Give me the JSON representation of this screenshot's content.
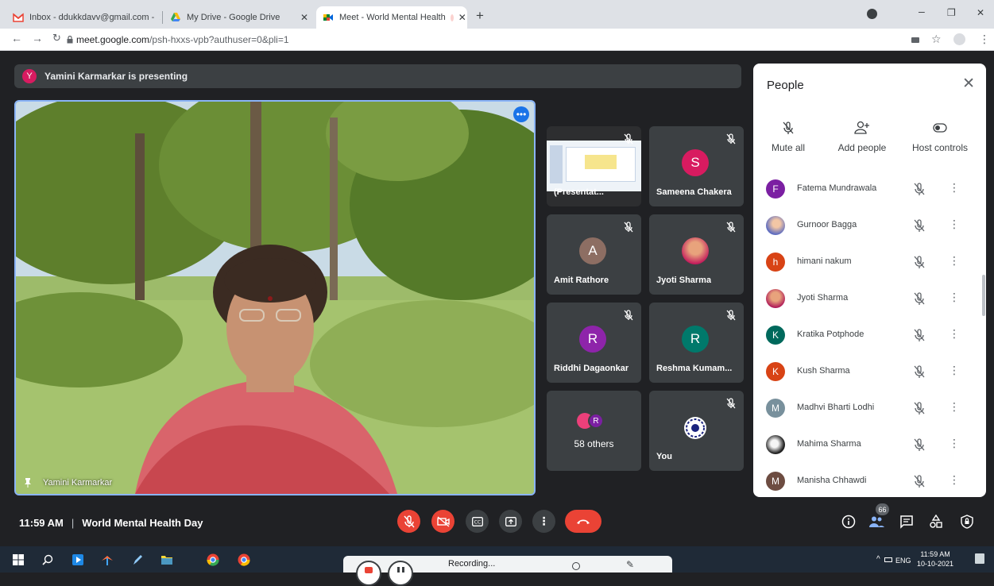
{
  "browser": {
    "tabs": [
      {
        "title": "Inbox - ddukkdavv@gmail.com - ",
        "active": false
      },
      {
        "title": "My Drive - Google Drive",
        "active": false
      },
      {
        "title": "Meet - World Mental Health",
        "active": true
      }
    ],
    "new_tab": "+",
    "url_host": "meet.google.com",
    "url_path": "/psh-hxxs-vpb?authuser=0&pli=1",
    "window_controls": {
      "minimize": "–",
      "maximize": "❐",
      "close": "✕"
    }
  },
  "meet": {
    "presenting_avatar": "Y",
    "presenting_text": "Yamini Karmarkar is presenting",
    "main_speaker": "Yamini Karmarkar",
    "tiles": [
      {
        "name": "(Presentat...",
        "type": "presentation"
      },
      {
        "name": "Sameena Chakera",
        "avatar": "S",
        "color": "#d81b60"
      },
      {
        "name": "Amit Rathore",
        "avatar": "A",
        "color": "#8d6e63"
      },
      {
        "name": "Jyoti Sharma",
        "avatar": "",
        "color": "#c2185b"
      },
      {
        "name": "Riddhi Dagaonkar",
        "avatar": "R",
        "color": "#8e24aa"
      },
      {
        "name": "Reshma Kumam...",
        "avatar": "R",
        "color": "#00796b"
      },
      {
        "name": "58 others",
        "avatar": "R",
        "color": "#7b1fa2"
      },
      {
        "name": "You",
        "avatar": "",
        "color": "#ffffff"
      }
    ],
    "people_panel": {
      "title": "People",
      "controls": [
        "Mute all",
        "Add people",
        "Host controls"
      ],
      "participants": [
        {
          "name": "Fatema Mundrawala",
          "initial": "F",
          "color": "#7b1fa2"
        },
        {
          "name": "Gurnoor Bagga",
          "initial": "",
          "color": "#5c6bc0"
        },
        {
          "name": "himani nakum",
          "initial": "h",
          "color": "#d84315"
        },
        {
          "name": "Jyoti Sharma",
          "initial": "",
          "color": "#ad1457"
        },
        {
          "name": "Kratika Potphode",
          "initial": "K",
          "color": "#00695c"
        },
        {
          "name": "Kush Sharma",
          "initial": "K",
          "color": "#d84315"
        },
        {
          "name": "Madhvi Bharti Lodhi",
          "initial": "M",
          "color": "#78909c"
        },
        {
          "name": "Mahima Sharma",
          "initial": "",
          "color": "#212121"
        },
        {
          "name": "Manisha Chhawdi",
          "initial": "M",
          "color": "#6d4c41"
        }
      ]
    },
    "bottom": {
      "time": "11:59 AM",
      "separator": "|",
      "meeting_name": "World Mental Health Day",
      "participant_count": "66"
    }
  },
  "taskbar": {
    "recording_label": "Recording...",
    "language": "ENG",
    "time": "11:59 AM",
    "date": "10-10-2021"
  },
  "colors": {
    "accent": "#1a73e8",
    "danger": "#ea4335",
    "meet_bg": "#202124",
    "tile_bg": "#3c4043"
  }
}
